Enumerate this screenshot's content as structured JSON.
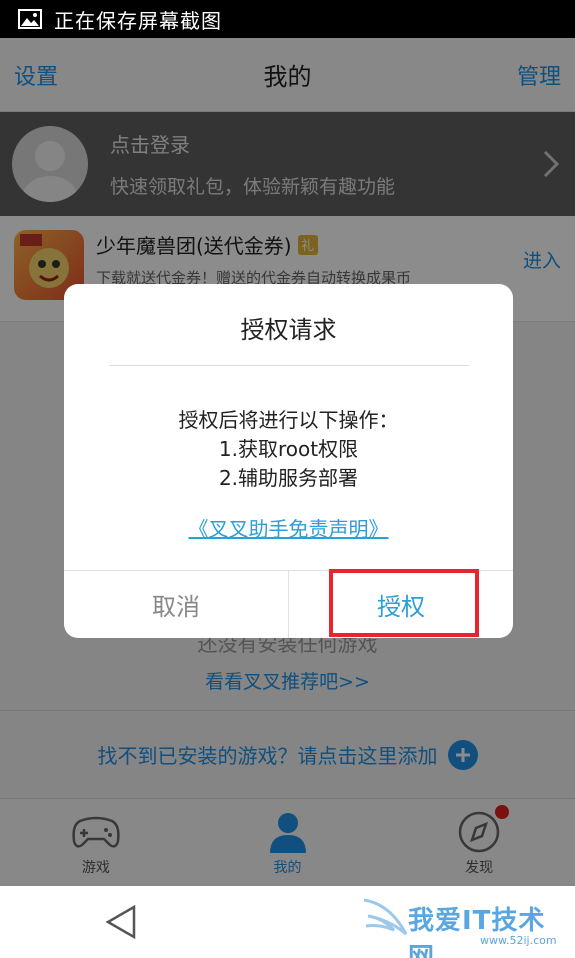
{
  "status_bar": {
    "text": "正在保存屏幕截图"
  },
  "header": {
    "left_btn": "设置",
    "title": "我的",
    "right_btn": "管理"
  },
  "login": {
    "title": "点击登录",
    "subtitle": "快速领取礼包，体验新颖有趣功能"
  },
  "game": {
    "title": "少年魔兽团(送代金券)",
    "badge": "礼",
    "desc": "下载就送代金券！赠送的代金券自动转换成果币",
    "enter": "进入"
  },
  "empty": {
    "text": "还没有安装任何游戏",
    "link": "看看叉叉推荐吧>>"
  },
  "add_game": {
    "text": "找不到已安装的游戏？请点击这里添加"
  },
  "tabs": [
    {
      "label": "游戏",
      "icon": "gamepad-icon"
    },
    {
      "label": "我的",
      "icon": "user-icon"
    },
    {
      "label": "发现",
      "icon": "compass-icon"
    }
  ],
  "dialog": {
    "title": "授权请求",
    "line1": "授权后将进行以下操作：",
    "line2": "1.获取root权限",
    "line3": "2.辅助服务部署",
    "link": "《叉叉助手免责声明》",
    "cancel": "取消",
    "confirm": "授权"
  },
  "watermark": {
    "text": "我爱IT技术网",
    "url": "www.52ij.com"
  },
  "colors": {
    "accent": "#1e90e6",
    "highlight": "#e8242c",
    "link": "#2a9fd8"
  }
}
